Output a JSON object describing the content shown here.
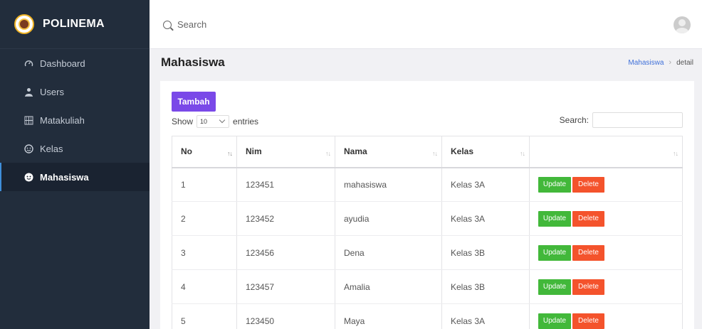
{
  "brand": {
    "name": "POLINEMA"
  },
  "sidebar": {
    "items": [
      {
        "label": "Dashboard",
        "icon": "gauge-icon"
      },
      {
        "label": "Users",
        "icon": "user-icon"
      },
      {
        "label": "Matakuliah",
        "icon": "grid-icon"
      },
      {
        "label": "Kelas",
        "icon": "smiley-icon"
      },
      {
        "label": "Mahasiswa",
        "icon": "smiley-icon",
        "active": true
      }
    ]
  },
  "topbar": {
    "search_placeholder": "Search"
  },
  "page": {
    "title": "Mahasiswa",
    "breadcrumb": {
      "link": "Mahasiswa",
      "current": "detail"
    }
  },
  "toolbar": {
    "add_label": "Tambah"
  },
  "table_controls": {
    "show_label": "Show",
    "entries_value": "10",
    "entries_label": "entries",
    "search_label": "Search:"
  },
  "table": {
    "columns": [
      "No",
      "Nim",
      "Nama",
      "Kelas",
      ""
    ],
    "rows": [
      {
        "no": "1",
        "nim": "123451",
        "nama": "mahasiswa",
        "kelas": "Kelas 3A"
      },
      {
        "no": "2",
        "nim": "123452",
        "nama": "ayudia",
        "kelas": "Kelas 3A"
      },
      {
        "no": "3",
        "nim": "123456",
        "nama": "Dena",
        "kelas": "Kelas 3B"
      },
      {
        "no": "4",
        "nim": "123457",
        "nama": "Amalia",
        "kelas": "Kelas 3B"
      },
      {
        "no": "5",
        "nim": "123450",
        "nama": "Maya",
        "kelas": "Kelas 3A"
      }
    ],
    "update_label": "Update",
    "delete_label": "Delete"
  },
  "colors": {
    "sidebar_bg": "#222d3c",
    "primary": "#7a49e8",
    "update": "#42b83a",
    "delete": "#f4532c",
    "link": "#3f70d9"
  }
}
